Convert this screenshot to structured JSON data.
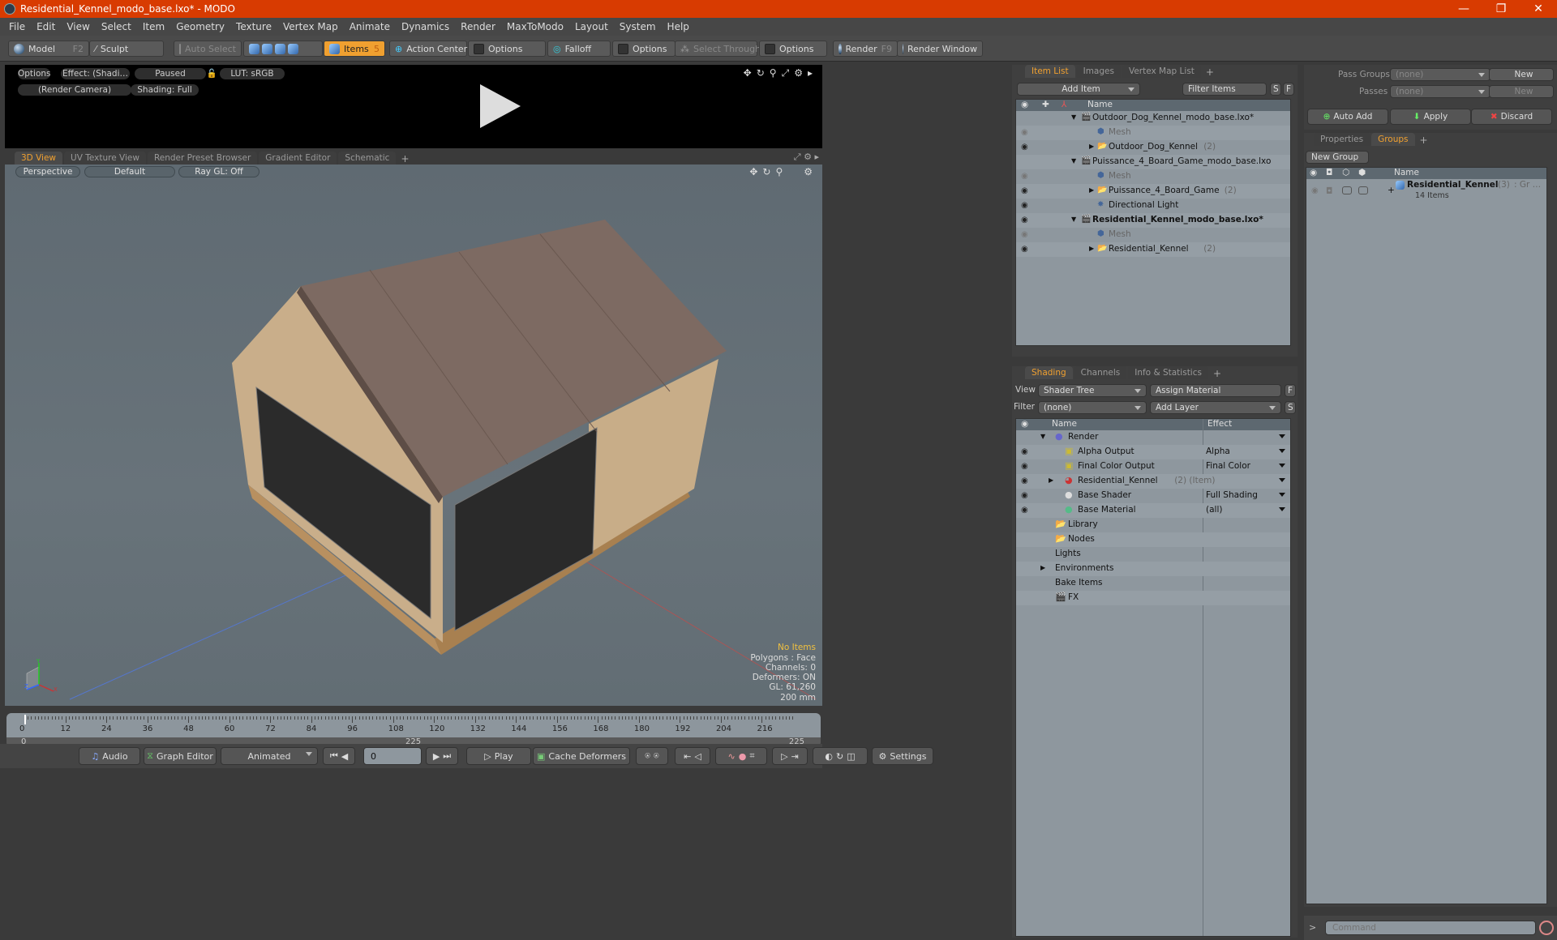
{
  "window": {
    "title": "Residential_Kennel_modo_base.lxo* - MODO",
    "min": "—",
    "max": "❐",
    "close": "✕"
  },
  "menu": [
    "File",
    "Edit",
    "View",
    "Select",
    "Item",
    "Geometry",
    "Texture",
    "Vertex Map",
    "Animate",
    "Dynamics",
    "Render",
    "MaxToModo",
    "Layout",
    "System",
    "Help"
  ],
  "toolbar": {
    "model": "Model",
    "model_key": "F2",
    "sculpt": "Sculpt",
    "auto_select": "Auto Select",
    "items": "Items",
    "items_count": "5",
    "action_center": "Action Center",
    "options1": "Options",
    "falloff": "Falloff",
    "options2": "Options",
    "select_through": "Select Through",
    "options3": "Options",
    "render": "Render",
    "render_key": "F9",
    "render_window": "Render Window",
    "accent": "#f0a030"
  },
  "preview": {
    "options": "Options",
    "effect": "Effect: (Shadi…",
    "status": "Paused",
    "lut": "LUT: sRGB",
    "camera": "(Render Camera)",
    "shading": "Shading: Full"
  },
  "viewport_tabs": [
    "3D View",
    "UV Texture View",
    "Render Preset Browser",
    "Gradient Editor",
    "Schematic"
  ],
  "viewport": {
    "projection": "Perspective",
    "style": "Default",
    "raygl": "Ray GL: Off",
    "stats": {
      "selection": "No Items",
      "polygons": "Polygons : Face",
      "channels": "Channels: 0",
      "deformers": "Deformers: ON",
      "gl": "GL: 61,260",
      "scale": "200 mm"
    },
    "axis": {
      "y": "Y",
      "x": "X",
      "z": "Z"
    }
  },
  "timeline": {
    "ticks": [
      "0",
      "12",
      "24",
      "36",
      "48",
      "60",
      "72",
      "84",
      "96",
      "108",
      "120",
      "132",
      "144",
      "156",
      "168",
      "180",
      "192",
      "204",
      "216"
    ],
    "start": "0",
    "mid": "225",
    "end": "225"
  },
  "transport": {
    "audio": "Audio",
    "graph_editor": "Graph Editor",
    "mode": "Animated",
    "frame": "0",
    "play": "Play",
    "cache_deformers": "Cache Deformers",
    "settings": "Settings"
  },
  "item_list": {
    "tabs": [
      "Item List",
      "Images",
      "Vertex Map List"
    ],
    "add_item": "Add Item",
    "filter": "Filter Items",
    "s": "S",
    "f": "F",
    "col_name": "Name",
    "rows": [
      {
        "label": "Outdoor_Dog_Kennel_modo_base.lxo*",
        "type": "scene",
        "indent": 0,
        "eye": false
      },
      {
        "label": "Mesh",
        "type": "mesh",
        "indent": 1,
        "eye": true,
        "dim": true
      },
      {
        "label": "Outdoor_Dog_Kennel",
        "count": "(2)",
        "type": "group",
        "indent": 1,
        "eye": true
      },
      {
        "label": "Puissance_4_Board_Game_modo_base.lxo",
        "type": "scene",
        "indent": 0,
        "eye": false
      },
      {
        "label": "Mesh",
        "type": "mesh",
        "indent": 1,
        "eye": true,
        "dim": true
      },
      {
        "label": "Puissance_4_Board_Game",
        "count": "(2)",
        "type": "group",
        "indent": 1,
        "eye": true
      },
      {
        "label": "Directional Light",
        "type": "light",
        "indent": 1,
        "eye": true
      },
      {
        "label": "Residential_Kennel_modo_base.lxo*",
        "type": "scene",
        "indent": 0,
        "eye": true,
        "bold": true
      },
      {
        "label": "Mesh",
        "type": "mesh",
        "indent": 1,
        "eye": true,
        "dim": true
      },
      {
        "label": "Residential_Kennel",
        "count": "(2)",
        "type": "group",
        "indent": 1,
        "eye": true
      }
    ]
  },
  "shading": {
    "tabs": [
      "Shading",
      "Channels",
      "Info & Statistics"
    ],
    "view_label": "View",
    "view": "Shader Tree",
    "assign": "Assign Material",
    "f": "F",
    "filter_label": "Filter",
    "filter": "(none)",
    "add_layer": "Add Layer",
    "s": "S",
    "col_name": "Name",
    "col_effect": "Effect",
    "rows": [
      {
        "label": "Render",
        "effect": "",
        "icon": "render",
        "indent": 0,
        "eye": false
      },
      {
        "label": "Alpha Output",
        "effect": "Alpha",
        "icon": "output",
        "indent": 1,
        "eye": true
      },
      {
        "label": "Final Color Output",
        "effect": "Final Color",
        "icon": "output",
        "indent": 1,
        "eye": true
      },
      {
        "label": "Residential_Kennel",
        "suffix": "(2) (Item)",
        "effect": "",
        "icon": "mask",
        "indent": 1,
        "eye": true
      },
      {
        "label": "Base Shader",
        "effect": "Full Shading",
        "icon": "shader",
        "indent": 1,
        "eye": true
      },
      {
        "label": "Base Material",
        "effect": "(all)",
        "icon": "material",
        "indent": 1,
        "eye": true
      },
      {
        "label": "Library",
        "icon": "folder",
        "indent": 0
      },
      {
        "label": "Nodes",
        "icon": "folder",
        "indent": 0
      },
      {
        "label": "Lights",
        "icon": "",
        "indent": 0
      },
      {
        "label": "Environments",
        "icon": "",
        "indent": 0,
        "expand": true
      },
      {
        "label": "Bake Items",
        "icon": "",
        "indent": 0
      },
      {
        "label": "FX",
        "icon": "fx",
        "indent": 0
      }
    ]
  },
  "passes": {
    "pass_groups_label": "Pass Groups",
    "pass_groups": "(none)",
    "new1": "New",
    "passes_label": "Passes",
    "passes": "(none)",
    "new2": "New",
    "auto_add": "Auto Add",
    "apply": "Apply",
    "discard": "Discard"
  },
  "groups": {
    "tabs": [
      "Properties",
      "Groups"
    ],
    "new_group": "New Group",
    "col_name": "Name",
    "row": {
      "label": "Residential_Kennel",
      "count": "(3)",
      "suffix": ": Gr …",
      "items": "14 Items"
    }
  },
  "command": {
    "prompt": ">",
    "placeholder": "Command"
  }
}
